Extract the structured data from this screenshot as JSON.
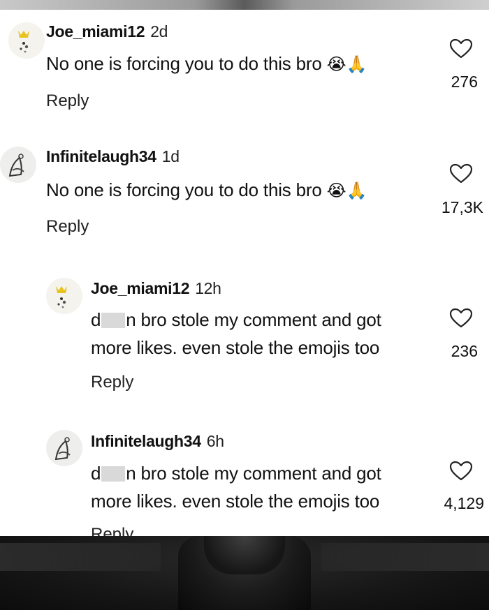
{
  "comments": [
    {
      "username": "Joe_miami12",
      "time": "2d",
      "text": "No one is forcing you to do this bro",
      "emoji": "😭🙏",
      "likes": "276",
      "reply": "Reply"
    },
    {
      "username": "Infinitelaugh34",
      "time": "1d",
      "text": "No one is forcing you to do this bro",
      "emoji": "😭🙏",
      "likes": "17,3K",
      "reply": "Reply"
    },
    {
      "username": "Joe_miami12",
      "time": "12h",
      "text_a1": "d",
      "text_a2": "n bro stole my comment and got",
      "text_b": "more likes. even stole the emojis too",
      "likes": "236",
      "reply": "Reply"
    },
    {
      "username": "Infinitelaugh34",
      "time": "6h",
      "text_a1": "d",
      "text_a2": "n bro stole my comment and got",
      "text_b": "more likes. even stole the emojis too",
      "likes": "4,129",
      "reply": "Reply"
    }
  ],
  "icons": {
    "heart": "heart-outline-icon",
    "avatar_joe": "crown-figure-avatar",
    "avatar_infinite": "sketch-figure-avatar"
  },
  "colors": {
    "card": "#ffffff",
    "text": "#111111",
    "background": "#1b1b1b"
  }
}
